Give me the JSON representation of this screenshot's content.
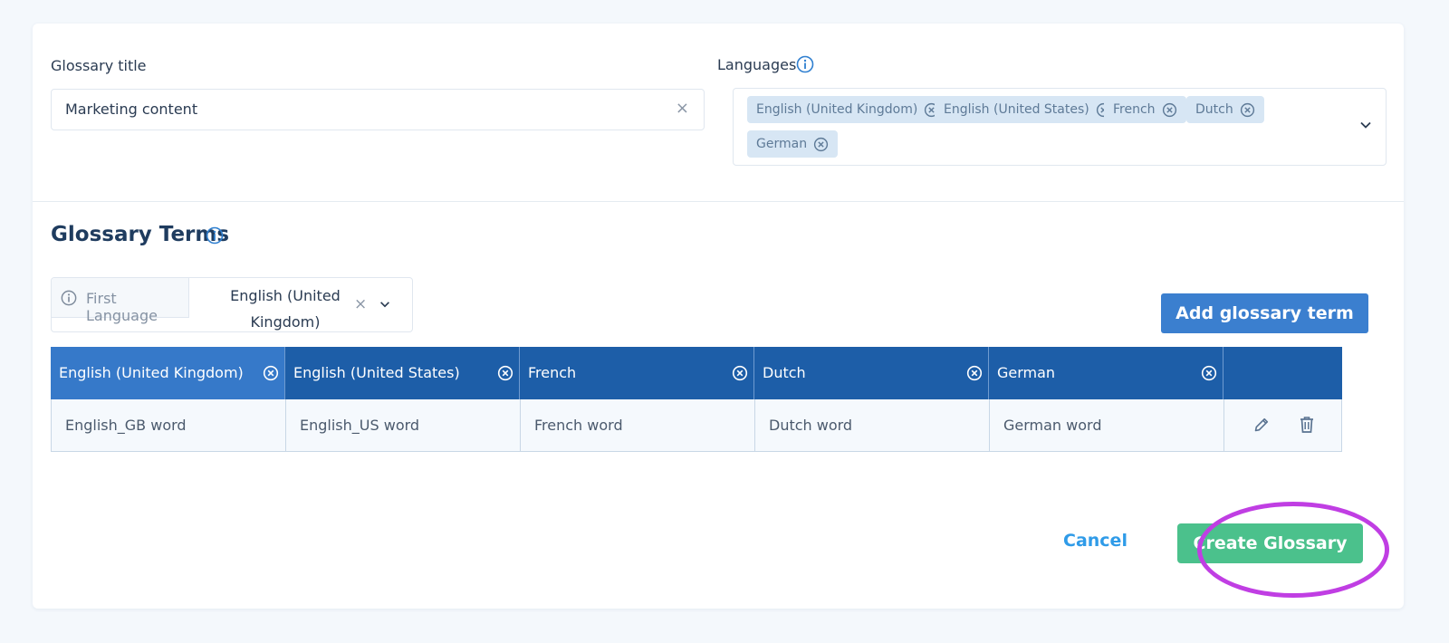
{
  "glossary_title": {
    "label": "Glossary title",
    "value": "Marketing content",
    "clear_symbol": "×"
  },
  "languages": {
    "label": "Languages",
    "chips": [
      "English (United Kingdom)",
      "English (United States)",
      "French",
      "Dutch",
      "German"
    ]
  },
  "terms": {
    "title": "Glossary Terms",
    "first_language": {
      "label": "First Language",
      "value": "English (United Kingdom)",
      "clear_symbol": "×"
    },
    "add_button": "Add glossary term",
    "columns": [
      "English (United Kingdom)",
      "English (United States)",
      "French",
      "Dutch",
      "German"
    ],
    "rows": [
      [
        "English_GB word",
        "English_US word",
        "French word",
        "Dutch word",
        "German word"
      ]
    ]
  },
  "footer": {
    "cancel": "Cancel",
    "create": "Create Glossary"
  },
  "colors": {
    "primary": "#3b7fcf",
    "header": "#1d5ea8",
    "header_active": "#3679c9",
    "success": "#4bc18c",
    "link": "#2f9be8",
    "highlight": "#c03ee3"
  },
  "icons": [
    "info-icon",
    "remove-circle-icon",
    "chevron-down-icon",
    "pencil-icon",
    "trash-icon"
  ]
}
